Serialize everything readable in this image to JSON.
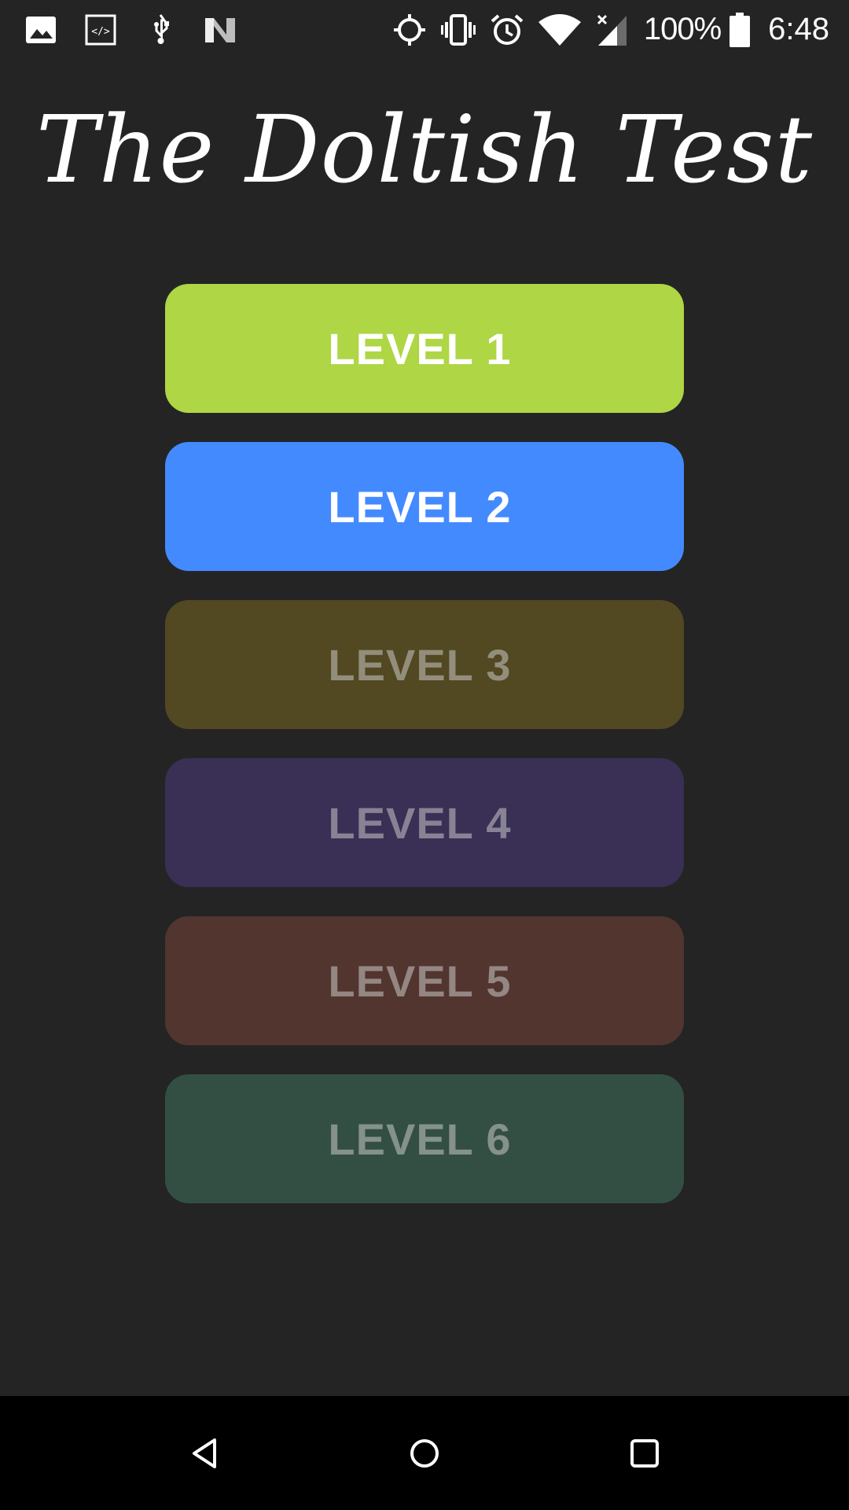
{
  "status_bar": {
    "left_icons": [
      "image-icon",
      "code-icon",
      "usb-icon",
      "n-logo-icon"
    ],
    "right_icons": [
      "gps-icon",
      "vibrate-icon",
      "alarm-icon",
      "wifi-icon",
      "signal-icon",
      "battery-icon"
    ],
    "battery_percent": "100%",
    "time": "6:48"
  },
  "title": "The Doltish Test",
  "levels": [
    {
      "label": "LEVEL 1",
      "color": "#aed645",
      "state": "unlocked"
    },
    {
      "label": "LEVEL 2",
      "color": "#448aff",
      "state": "unlocked"
    },
    {
      "label": "LEVEL 3",
      "color": "#524821",
      "state": "locked"
    },
    {
      "label": "LEVEL 4",
      "color": "#3a2f54",
      "state": "locked"
    },
    {
      "label": "LEVEL 5",
      "color": "#52352f",
      "state": "locked"
    },
    {
      "label": "LEVEL 6",
      "color": "#334f43",
      "state": "locked"
    }
  ],
  "nav_bar": {
    "buttons": [
      "back-icon",
      "home-icon",
      "recents-icon"
    ]
  },
  "colors": {
    "background": "#242424",
    "nav_background": "#000000",
    "text_active": "#ffffff"
  }
}
